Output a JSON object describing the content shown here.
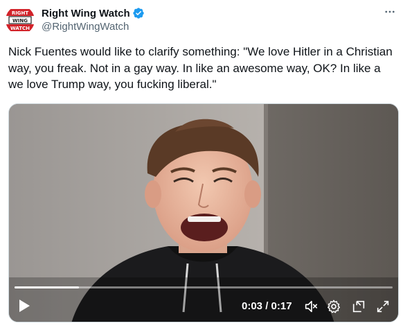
{
  "author": {
    "display_name": "Right Wing Watch",
    "handle": "@RightWingWatch",
    "avatar_text": [
      "RIGHT",
      "WING",
      "WATCH"
    ],
    "verified": true
  },
  "tweet": {
    "text": "Nick Fuentes would like to clarify something: \"We love Hitler in a Christian way, you freak. Not in a gay way. In like an awesome way, OK? In like a we love Trump way, you fucking liberal.\""
  },
  "video": {
    "time_display": "0:03 / 0:17",
    "progress_fraction": 0.17,
    "muted": true
  },
  "icons": {
    "more": "more-horizontal-icon",
    "verified": "verified-badge-icon",
    "play": "play-icon",
    "mute": "volume-muted-icon",
    "settings": "settings-gear-icon",
    "pip": "picture-in-picture-icon",
    "fullscreen": "fullscreen-expand-icon"
  },
  "colors": {
    "verified_blue": "#1d9bf0",
    "text_primary": "#0f1419",
    "text_secondary": "#536471",
    "brand_red": "#d2232a"
  }
}
